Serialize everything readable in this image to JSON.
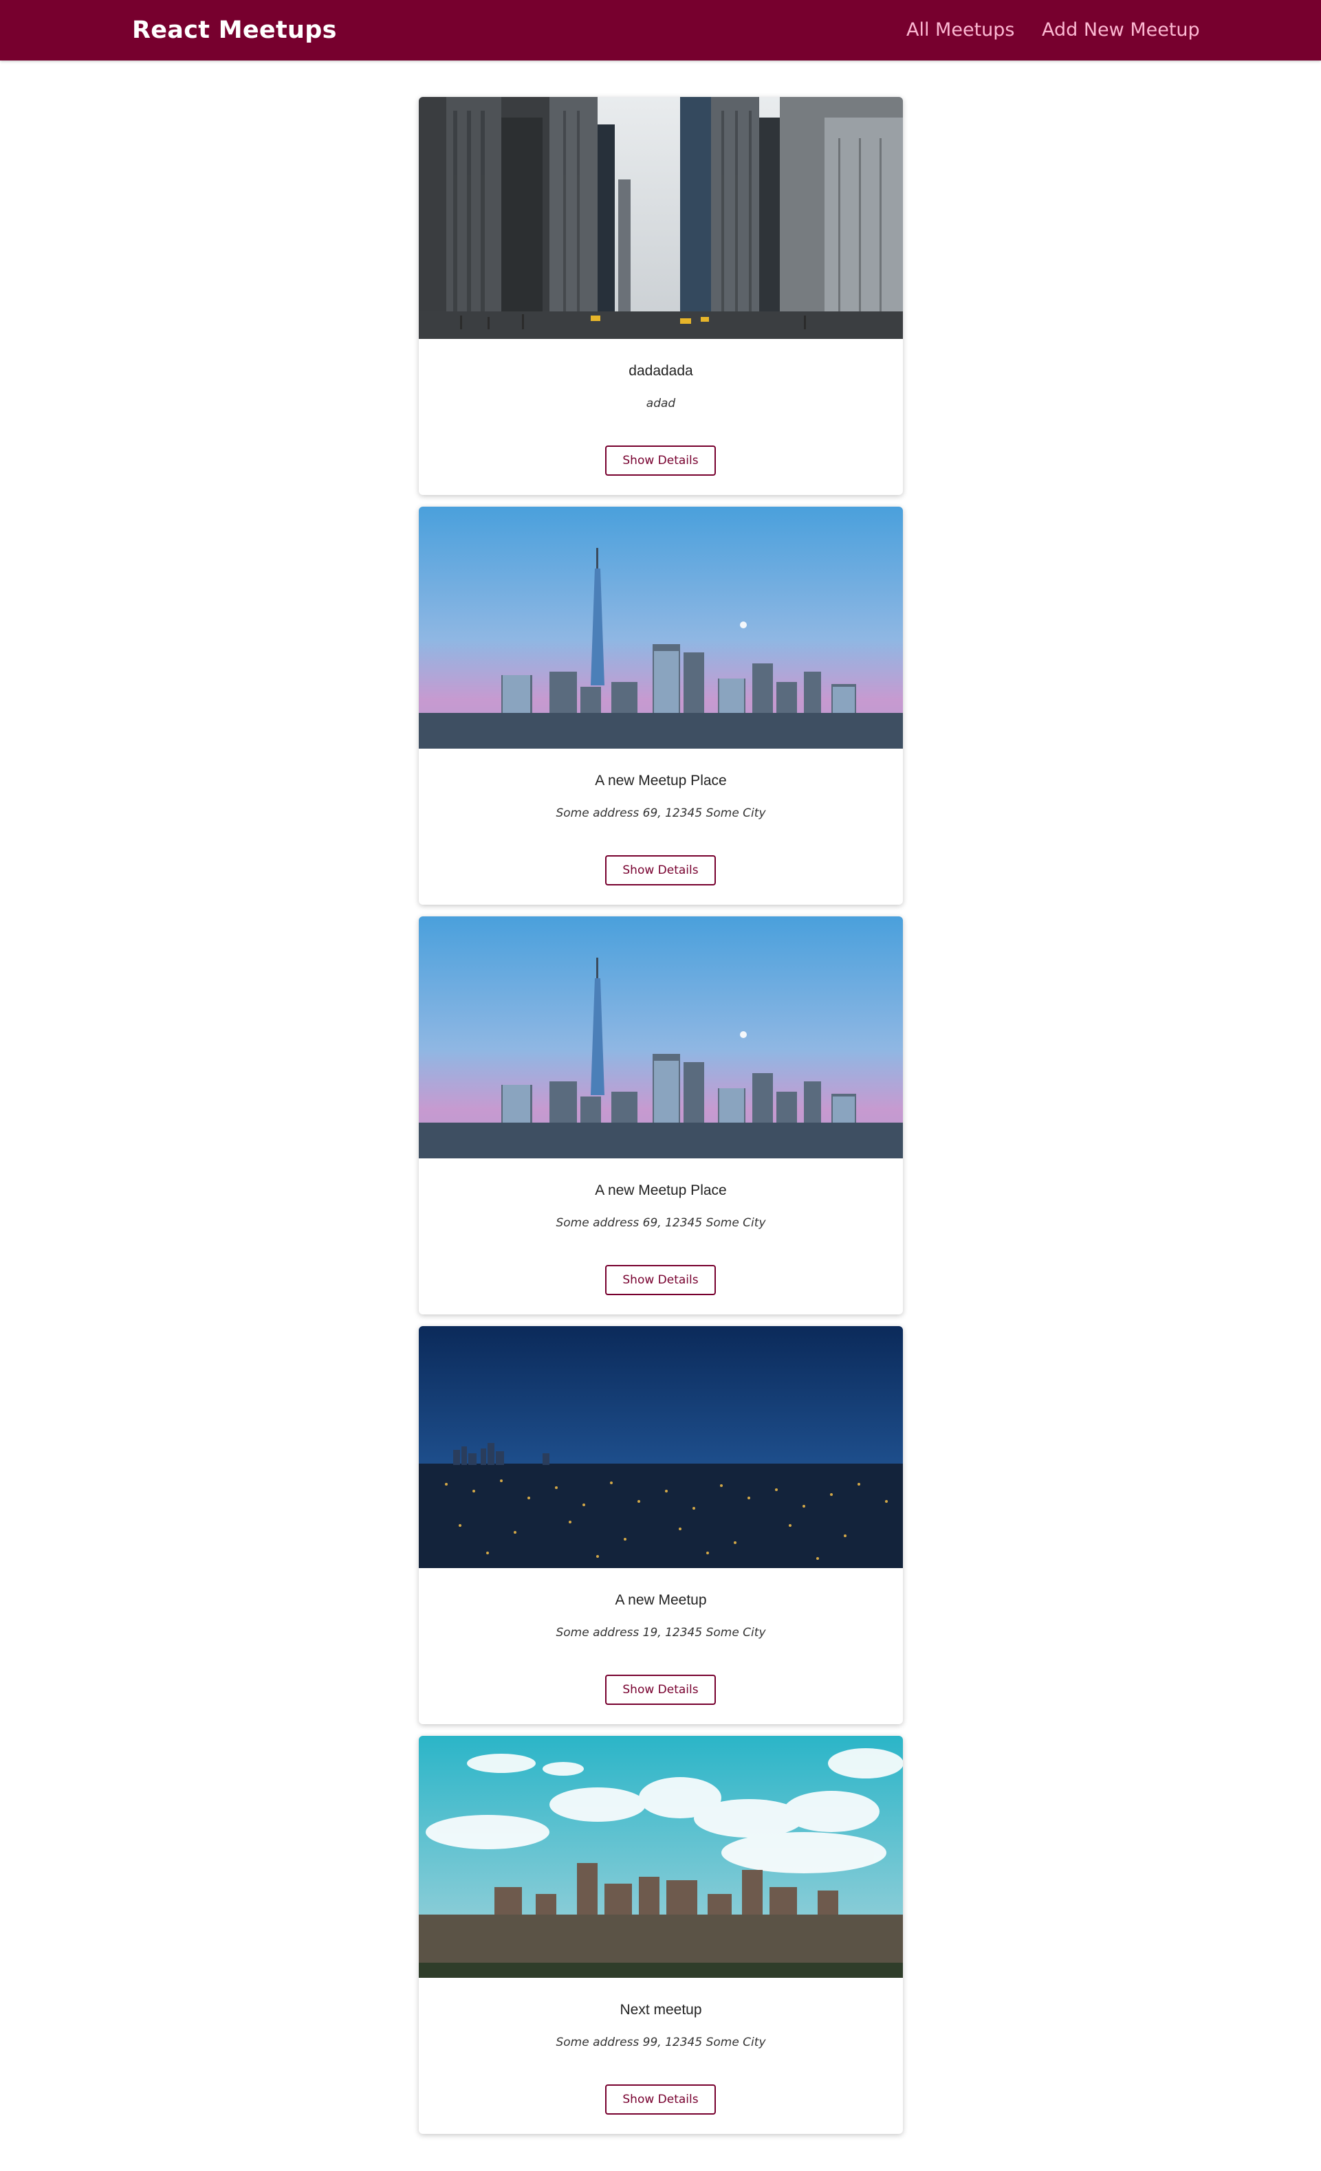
{
  "header": {
    "logo": "React Meetups",
    "nav": [
      "All Meetups",
      "Add New Meetup"
    ]
  },
  "meetups": [
    {
      "title": "dadadada",
      "address": "adad",
      "button": "Show Details",
      "image": "city-street-photo"
    },
    {
      "title": "A new Meetup Place",
      "address": "Some address 69, 12345 Some City",
      "button": "Show Details",
      "image": "skyline-dusk-photo"
    },
    {
      "title": "A new Meetup Place",
      "address": "Some address 69, 12345 Some City",
      "button": "Show Details",
      "image": "skyline-dusk-photo"
    },
    {
      "title": "A new Meetup",
      "address": "Some address 19, 12345 Some City",
      "button": "Show Details",
      "image": "city-night-photo"
    },
    {
      "title": "Next meetup",
      "address": "Some address 99, 12345 Some City",
      "button": "Show Details",
      "image": "city-daytime-photo"
    }
  ],
  "colors": {
    "brand": "#77002e",
    "nav_text": "#fcb8d2",
    "text": "#222222"
  }
}
